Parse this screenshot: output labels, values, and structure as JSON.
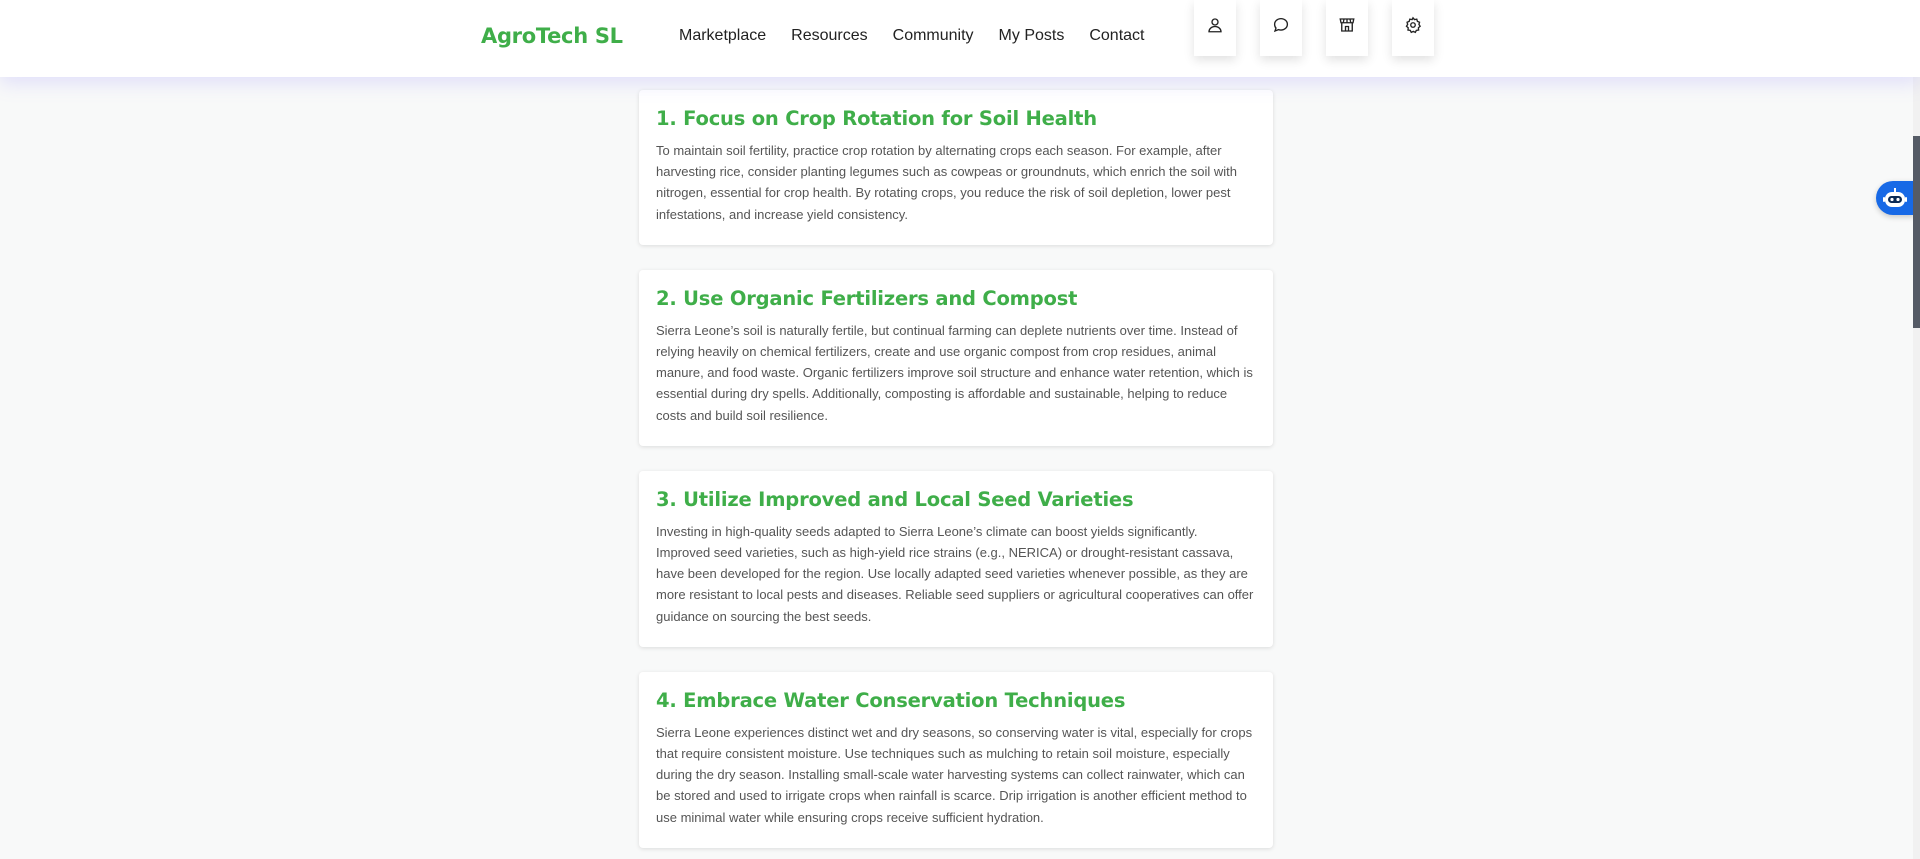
{
  "brand": "AgroTech SL",
  "nav": {
    "links": [
      "Marketplace",
      "Resources",
      "Community",
      "My Posts",
      "Contact"
    ],
    "icons": [
      "user-icon",
      "chat-icon",
      "store-icon",
      "settings-icon"
    ]
  },
  "articles": [
    {
      "title": "1. Focus on Crop Rotation for Soil Health",
      "body": "To maintain soil fertility, practice crop rotation by alternating crops each season. For example, after harvesting rice, consider planting legumes such as cowpeas or groundnuts, which enrich the soil with nitrogen, essential for crop health. By rotating crops, you reduce the risk of soil depletion, lower pest infestations, and increase yield consistency."
    },
    {
      "title": "2. Use Organic Fertilizers and Compost",
      "body": "Sierra Leone’s soil is naturally fertile, but continual farming can deplete nutrients over time. Instead of relying heavily on chemical fertilizers, create and use organic compost from crop residues, animal manure, and food waste. Organic fertilizers improve soil structure and enhance water retention, which is essential during dry spells. Additionally, composting is affordable and sustainable, helping to reduce costs and build soil resilience."
    },
    {
      "title": "3. Utilize Improved and Local Seed Varieties",
      "body": "Investing in high-quality seeds adapted to Sierra Leone’s climate can boost yields significantly. Improved seed varieties, such as high-yield rice strains (e.g., NERICA) or drought-resistant cassava, have been developed for the region. Use locally adapted seed varieties whenever possible, as they are more resistant to local pests and diseases. Reliable seed suppliers or agricultural cooperatives can offer guidance on sourcing the best seeds."
    },
    {
      "title": "4. Embrace Water Conservation Techniques",
      "body": "Sierra Leone experiences distinct wet and dry seasons, so conserving water is vital, especially for crops that require consistent moisture. Use techniques such as mulching to retain soil moisture, especially during the dry season. Installing small-scale water harvesting systems can collect rainwater, which can be stored and used to irrigate crops when rainfall is scarce. Drip irrigation is another efficient method to use minimal water while ensuring crops receive sufficient hydration."
    }
  ],
  "colors": {
    "brand_green": "#3fae49",
    "chat_fab_blue": "#1769e6"
  }
}
